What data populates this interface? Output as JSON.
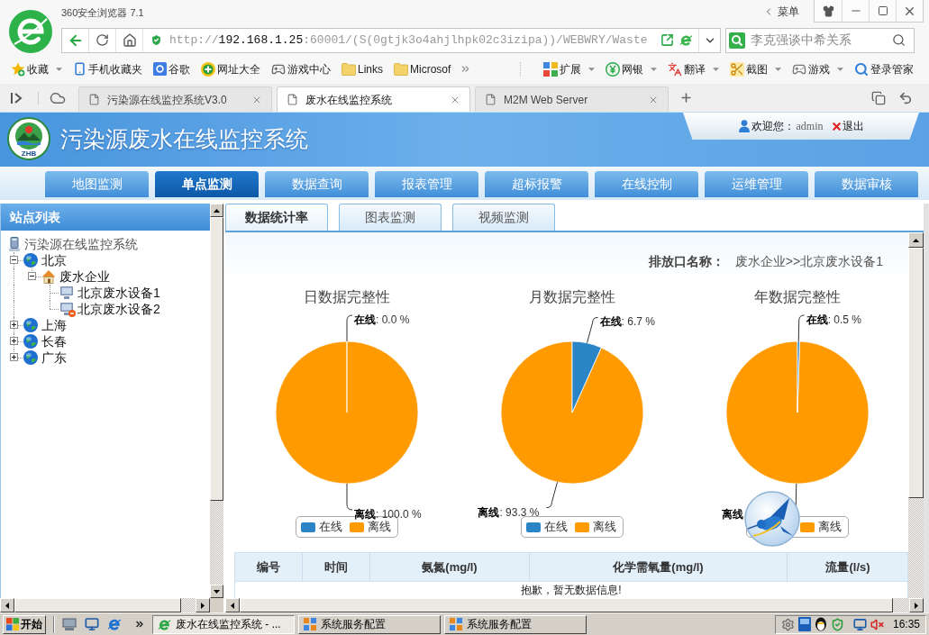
{
  "browser": {
    "title": "360安全浏览器 7.1",
    "menu": "菜单",
    "url": {
      "scheme": "http://",
      "host": "192.168.1.25",
      "path": ":60001/(S(0gtjk3o4ahjlhpk02c3izipa))/WEBWRY/Waste"
    },
    "search": {
      "placeholder": "李克强谈中希关系"
    },
    "bookmarks": [
      {
        "kind": "star",
        "label": "收藏",
        "dropdown": true
      },
      {
        "kind": "phone",
        "label": "手机收藏夹",
        "dropdown": false
      },
      {
        "kind": "google",
        "label": "谷歌",
        "dropdown": false
      },
      {
        "kind": "sites",
        "label": "网址大全",
        "dropdown": false
      },
      {
        "kind": "gamepad",
        "label": "游戏中心",
        "dropdown": false
      },
      {
        "kind": "folder",
        "label": "Links",
        "dropdown": false
      },
      {
        "kind": "folder",
        "label": "Microsof",
        "dropdown": false
      }
    ],
    "toolbar": [
      {
        "kind": "extensions",
        "label": "扩展",
        "dropdown": true
      },
      {
        "kind": "bank",
        "label": "网银",
        "dropdown": true
      },
      {
        "kind": "translate",
        "label": "翻译",
        "dropdown": true
      },
      {
        "kind": "screenshot",
        "label": "截图",
        "dropdown": true
      },
      {
        "kind": "games",
        "label": "游戏",
        "dropdown": true
      },
      {
        "kind": "login",
        "label": "登录管家",
        "dropdown": false
      }
    ],
    "tabs": [
      {
        "label": "污染源在线监控系统V3.0",
        "selected": false
      },
      {
        "label": "废水在线监控系统",
        "selected": true
      },
      {
        "label": "M2M Web Server",
        "selected": false
      }
    ]
  },
  "header": {
    "logo_text": "ZHB",
    "title": "污染源废水在线监控系统",
    "welcome": {
      "greeting": "欢迎您：",
      "user": "admin",
      "logout": "退出"
    }
  },
  "nav": [
    {
      "label": "地图监测",
      "selected": false
    },
    {
      "label": "单点监测",
      "selected": true
    },
    {
      "label": "数据查询",
      "selected": false
    },
    {
      "label": "报表管理",
      "selected": false
    },
    {
      "label": "超标报警",
      "selected": false
    },
    {
      "label": "在线控制",
      "selected": false
    },
    {
      "label": "运维管理",
      "selected": false
    },
    {
      "label": "数据审核",
      "selected": false
    }
  ],
  "sidebar": {
    "title": "站点列表",
    "tree": [
      {
        "label": "污染源在线监控系统",
        "kind": "root"
      },
      {
        "label": "北京",
        "kind": "region",
        "expanded": true,
        "children": [
          {
            "label": "废水企业",
            "kind": "company",
            "expanded": true,
            "children": [
              {
                "label": "北京废水设备1",
                "kind": "device",
                "alert": false
              },
              {
                "label": "北京废水设备2",
                "kind": "device",
                "alert": true
              }
            ]
          }
        ]
      },
      {
        "label": "上海",
        "kind": "region",
        "expanded": false
      },
      {
        "label": "长春",
        "kind": "region",
        "expanded": false
      },
      {
        "label": "广东",
        "kind": "region",
        "expanded": false
      }
    ]
  },
  "content": {
    "tabs": [
      {
        "label": "数据统计率",
        "selected": true
      },
      {
        "label": "图表监测",
        "selected": false
      },
      {
        "label": "视频监测",
        "selected": false
      }
    ],
    "outlet": {
      "label": "排放口名称：",
      "value": "废水企业>>北京废水设备1"
    },
    "charts": [
      {
        "chart_data": {
          "type": "pie",
          "title": "日数据完整性",
          "categories": [
            "在线",
            "离线"
          ],
          "values": [
            0.0,
            100.0
          ],
          "colors": [
            "#2a84c6",
            "#ff9a00"
          ],
          "value_labels": [
            ": 0.0 %",
            ": 100.0 %"
          ],
          "legend": {
            "visible": [
              true,
              true
            ]
          }
        }
      },
      {
        "chart_data": {
          "type": "pie",
          "title": "月数据完整性",
          "categories": [
            "在线",
            "离线"
          ],
          "values": [
            6.7,
            93.3
          ],
          "colors": [
            "#2a84c6",
            "#ff9a00"
          ],
          "value_labels": [
            ": 6.7 %",
            ": 93.3 %"
          ],
          "legend": {
            "visible": [
              true,
              true
            ]
          }
        }
      },
      {
        "chart_data": {
          "type": "pie",
          "title": "年数据完整性",
          "categories": [
            "在线",
            "离线"
          ],
          "values": [
            0.5,
            99.5
          ],
          "colors": [
            "#2a84c6",
            "#ff9a00"
          ],
          "value_labels": [
            ": 0.5 %",
            null
          ],
          "legend": {
            "visible": [
              false,
              true
            ]
          }
        }
      }
    ],
    "table": {
      "columns": [
        "编号",
        "时间",
        "氨氮(mg/l)",
        "化学需氧量(mg/l)",
        "流量(l/s)"
      ],
      "empty_message": "抱歉，暂无数据信息!"
    }
  },
  "taskbar": {
    "start": "开始",
    "tasks": [
      {
        "kind": "browser",
        "label": "废水在线监控系统 - ...",
        "selected": true
      },
      {
        "kind": "app",
        "label": "系统服务配置",
        "selected": false
      },
      {
        "kind": "app",
        "label": "系统服务配置",
        "selected": false
      }
    ],
    "clock": "16:35"
  }
}
